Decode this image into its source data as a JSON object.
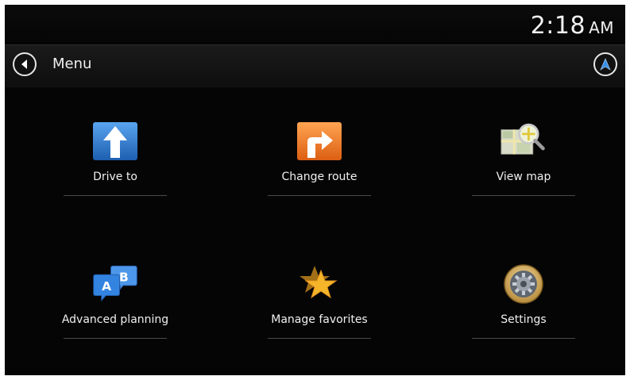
{
  "status": {
    "time": "2:18",
    "ampm": "AM"
  },
  "header": {
    "title": "Menu"
  },
  "icons": {
    "back": "back-arrow-icon",
    "navigate": "navigation-arrow-icon"
  },
  "colors": {
    "accent_blue": "#2f7fd6",
    "orange": "#f07a22",
    "gold": "#f5b52a"
  },
  "menu": {
    "items": [
      {
        "label": "Drive to",
        "icon": "drive-to-arrow-icon"
      },
      {
        "label": "Change route",
        "icon": "change-route-icon"
      },
      {
        "label": "View map",
        "icon": "map-magnifier-icon"
      },
      {
        "label": "Advanced planning",
        "icon": "ab-planning-icon"
      },
      {
        "label": "Manage favorites",
        "icon": "favorites-star-icon"
      },
      {
        "label": "Settings",
        "icon": "settings-gear-icon"
      }
    ]
  }
}
